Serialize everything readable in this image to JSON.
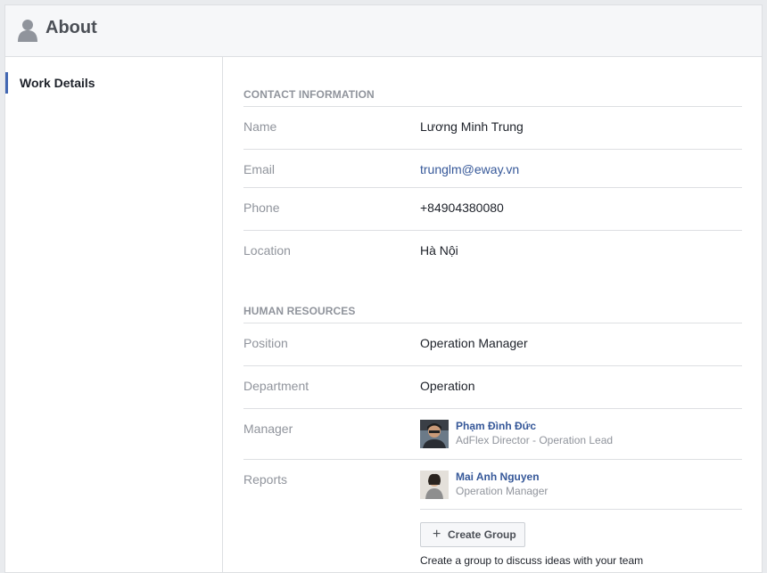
{
  "header": {
    "title": "About",
    "icon": "person-silhouette-icon"
  },
  "sidebar": {
    "items": [
      {
        "label": "Work Details",
        "active": true
      }
    ]
  },
  "contact": {
    "section_title": "CONTACT INFORMATION",
    "rows": [
      {
        "label": "Name",
        "value": "Lương Minh Trung"
      },
      {
        "label": "Email",
        "value": "trunglm@eway.vn"
      },
      {
        "label": "Phone",
        "value": "+84904380080"
      },
      {
        "label": "Location",
        "value": "Hà Nội"
      }
    ]
  },
  "hr": {
    "section_title": "HUMAN RESOURCES",
    "position": {
      "label": "Position",
      "value": "Operation Manager"
    },
    "department": {
      "label": "Department",
      "value": "Operation"
    },
    "manager": {
      "label": "Manager",
      "name": "Phạm Đình Đức",
      "title": "AdFlex Director - Operation Lead"
    },
    "reports": {
      "label": "Reports",
      "name": "Mai Anh Nguyen",
      "title": "Operation Manager"
    }
  },
  "create_group": {
    "button_label": "Create Group",
    "icon": "plus-icon",
    "hint": "Create a group to discuss ideas with your team"
  },
  "colors": {
    "link": "#365899",
    "accent": "#4267b2",
    "muted": "#90949c"
  }
}
